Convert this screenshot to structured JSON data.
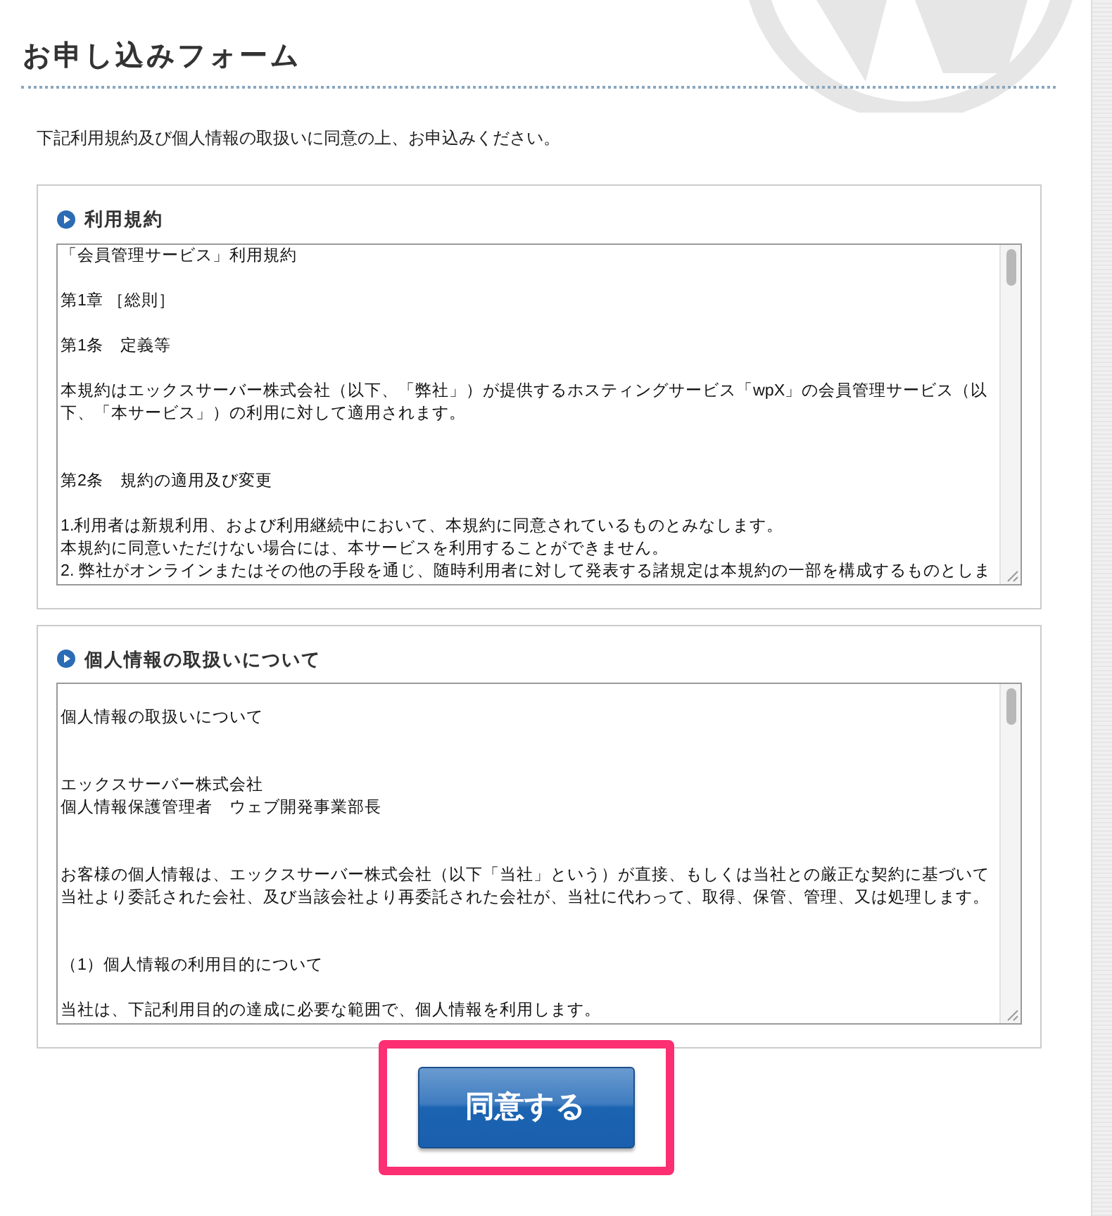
{
  "title": "お申し込みフォーム",
  "intro": "下記利用規約及び個人情報の取扱いに同意の上、お申込みください。",
  "sections": [
    {
      "heading": "利用規約",
      "lines": [
        {
          "text": "「会員管理サービス」利用規約",
          "kind": "plain"
        },
        {
          "text": "第1章 ［総則］",
          "kind": "spaced"
        },
        {
          "text": "第1条　定義等",
          "kind": "spaced"
        },
        {
          "text": "本規約はエックスサーバー株式会社（以下、「弊社」）が提供するホスティングサービス「wpX」の会員管理サービス（以",
          "kind": "spaced"
        },
        {
          "text": "下、「本サービス」）の利用に対して適用されます。",
          "kind": "plain"
        },
        {
          "text": "第2条　規約の適用及び変更",
          "kind": "wide"
        },
        {
          "text": "1.利用者は新規利用、および利用継続中において、本規約に同意されているものとみなします。",
          "kind": "spaced"
        },
        {
          "text": "本規約に同意いただけない場合には、本サービスを利用することができません。",
          "kind": "plain"
        },
        {
          "text": "2. 弊社がオンラインまたはその他の手段を通じ、随時利用者に対して発表する諸規定は本規約の一部を構成するものとしま",
          "kind": "plain"
        }
      ]
    },
    {
      "heading": "個人情報の取扱いについて",
      "lines": [
        {
          "text": "個人情報の取扱いについて",
          "kind": "spaced"
        },
        {
          "text": "エックスサーバー株式会社",
          "kind": "wide"
        },
        {
          "text": "個人情報保護管理者　ウェブ開発事業部長",
          "kind": "plain"
        },
        {
          "text": "お客様の個人情報は、エックスサーバー株式会社（以下「当社」という）が直接、もしくは当社との厳正な契約に基づいて",
          "kind": "wide"
        },
        {
          "text": "当社より委託された会社、及び当該会社より再委託された会社が、当社に代わって、取得、保管、管理、又は処理します。",
          "kind": "plain"
        },
        {
          "text": "（1）個人情報の利用目的について",
          "kind": "wide"
        },
        {
          "text": "当社は、下記利用目的の達成に必要な範囲で、個人情報を利用します。",
          "kind": "spaced"
        }
      ]
    }
  ],
  "agree_button": {
    "label": "同意する",
    "highlighted": true
  }
}
